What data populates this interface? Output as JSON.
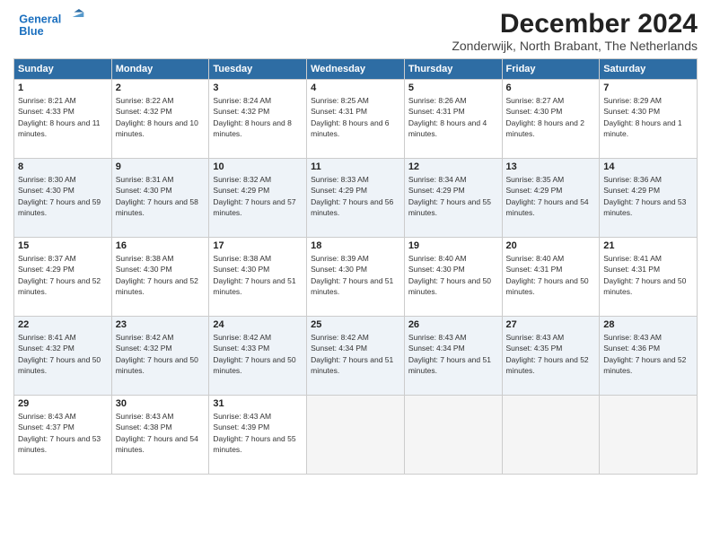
{
  "header": {
    "logo_line1": "General",
    "logo_line2": "Blue",
    "month": "December 2024",
    "location": "Zonderwijk, North Brabant, The Netherlands"
  },
  "weekdays": [
    "Sunday",
    "Monday",
    "Tuesday",
    "Wednesday",
    "Thursday",
    "Friday",
    "Saturday"
  ],
  "weeks": [
    [
      {
        "day": "1",
        "sunrise": "8:21 AM",
        "sunset": "4:33 PM",
        "daylight": "8 hours and 11 minutes."
      },
      {
        "day": "2",
        "sunrise": "8:22 AM",
        "sunset": "4:32 PM",
        "daylight": "8 hours and 10 minutes."
      },
      {
        "day": "3",
        "sunrise": "8:24 AM",
        "sunset": "4:32 PM",
        "daylight": "8 hours and 8 minutes."
      },
      {
        "day": "4",
        "sunrise": "8:25 AM",
        "sunset": "4:31 PM",
        "daylight": "8 hours and 6 minutes."
      },
      {
        "day": "5",
        "sunrise": "8:26 AM",
        "sunset": "4:31 PM",
        "daylight": "8 hours and 4 minutes."
      },
      {
        "day": "6",
        "sunrise": "8:27 AM",
        "sunset": "4:30 PM",
        "daylight": "8 hours and 2 minutes."
      },
      {
        "day": "7",
        "sunrise": "8:29 AM",
        "sunset": "4:30 PM",
        "daylight": "8 hours and 1 minute."
      }
    ],
    [
      {
        "day": "8",
        "sunrise": "8:30 AM",
        "sunset": "4:30 PM",
        "daylight": "7 hours and 59 minutes."
      },
      {
        "day": "9",
        "sunrise": "8:31 AM",
        "sunset": "4:30 PM",
        "daylight": "7 hours and 58 minutes."
      },
      {
        "day": "10",
        "sunrise": "8:32 AM",
        "sunset": "4:29 PM",
        "daylight": "7 hours and 57 minutes."
      },
      {
        "day": "11",
        "sunrise": "8:33 AM",
        "sunset": "4:29 PM",
        "daylight": "7 hours and 56 minutes."
      },
      {
        "day": "12",
        "sunrise": "8:34 AM",
        "sunset": "4:29 PM",
        "daylight": "7 hours and 55 minutes."
      },
      {
        "day": "13",
        "sunrise": "8:35 AM",
        "sunset": "4:29 PM",
        "daylight": "7 hours and 54 minutes."
      },
      {
        "day": "14",
        "sunrise": "8:36 AM",
        "sunset": "4:29 PM",
        "daylight": "7 hours and 53 minutes."
      }
    ],
    [
      {
        "day": "15",
        "sunrise": "8:37 AM",
        "sunset": "4:29 PM",
        "daylight": "7 hours and 52 minutes."
      },
      {
        "day": "16",
        "sunrise": "8:38 AM",
        "sunset": "4:30 PM",
        "daylight": "7 hours and 52 minutes."
      },
      {
        "day": "17",
        "sunrise": "8:38 AM",
        "sunset": "4:30 PM",
        "daylight": "7 hours and 51 minutes."
      },
      {
        "day": "18",
        "sunrise": "8:39 AM",
        "sunset": "4:30 PM",
        "daylight": "7 hours and 51 minutes."
      },
      {
        "day": "19",
        "sunrise": "8:40 AM",
        "sunset": "4:30 PM",
        "daylight": "7 hours and 50 minutes."
      },
      {
        "day": "20",
        "sunrise": "8:40 AM",
        "sunset": "4:31 PM",
        "daylight": "7 hours and 50 minutes."
      },
      {
        "day": "21",
        "sunrise": "8:41 AM",
        "sunset": "4:31 PM",
        "daylight": "7 hours and 50 minutes."
      }
    ],
    [
      {
        "day": "22",
        "sunrise": "8:41 AM",
        "sunset": "4:32 PM",
        "daylight": "7 hours and 50 minutes."
      },
      {
        "day": "23",
        "sunrise": "8:42 AM",
        "sunset": "4:32 PM",
        "daylight": "7 hours and 50 minutes."
      },
      {
        "day": "24",
        "sunrise": "8:42 AM",
        "sunset": "4:33 PM",
        "daylight": "7 hours and 50 minutes."
      },
      {
        "day": "25",
        "sunrise": "8:42 AM",
        "sunset": "4:34 PM",
        "daylight": "7 hours and 51 minutes."
      },
      {
        "day": "26",
        "sunrise": "8:43 AM",
        "sunset": "4:34 PM",
        "daylight": "7 hours and 51 minutes."
      },
      {
        "day": "27",
        "sunrise": "8:43 AM",
        "sunset": "4:35 PM",
        "daylight": "7 hours and 52 minutes."
      },
      {
        "day": "28",
        "sunrise": "8:43 AM",
        "sunset": "4:36 PM",
        "daylight": "7 hours and 52 minutes."
      }
    ],
    [
      {
        "day": "29",
        "sunrise": "8:43 AM",
        "sunset": "4:37 PM",
        "daylight": "7 hours and 53 minutes."
      },
      {
        "day": "30",
        "sunrise": "8:43 AM",
        "sunset": "4:38 PM",
        "daylight": "7 hours and 54 minutes."
      },
      {
        "day": "31",
        "sunrise": "8:43 AM",
        "sunset": "4:39 PM",
        "daylight": "7 hours and 55 minutes."
      },
      null,
      null,
      null,
      null
    ]
  ]
}
